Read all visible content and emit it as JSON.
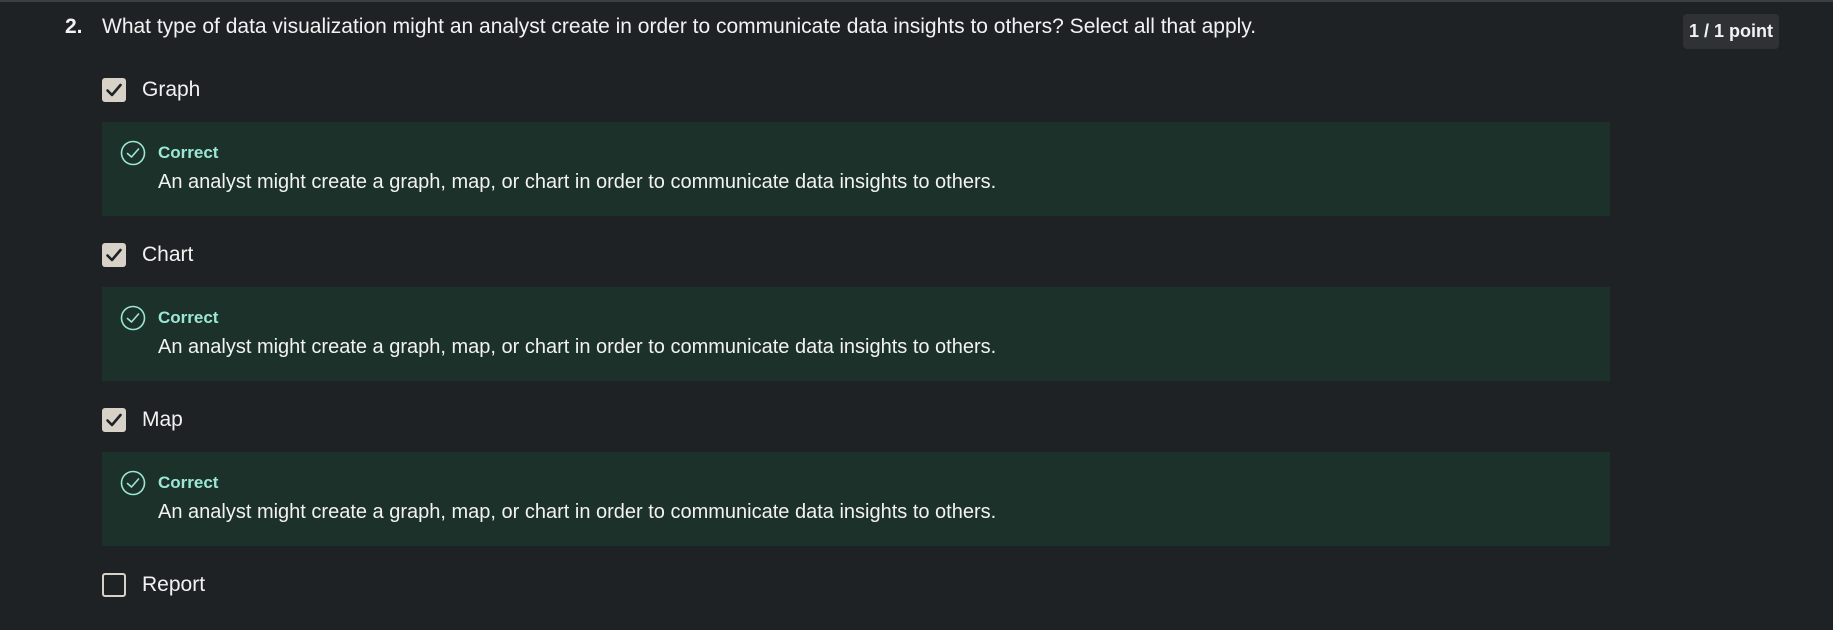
{
  "question": {
    "number": "2.",
    "text": "What type of data visualization might an analyst create in order to communicate data insights to others? Select all that apply.",
    "points": "1 / 1 point"
  },
  "options": [
    {
      "label": "Graph",
      "checked": true,
      "feedback": {
        "status": "Correct",
        "text": "An analyst might create a graph, map, or chart in order to communicate data insights to others."
      }
    },
    {
      "label": "Chart",
      "checked": true,
      "feedback": {
        "status": "Correct",
        "text": "An analyst might create a graph, map, or chart in order to communicate data insights to others."
      }
    },
    {
      "label": "Map",
      "checked": true,
      "feedback": {
        "status": "Correct",
        "text": "An analyst might create a graph, map, or chart in order to communicate data insights to others."
      }
    },
    {
      "label": "Report",
      "checked": false
    }
  ],
  "colors": {
    "background": "#1f2224",
    "feedback_background": "#1c3129",
    "correct_accent": "#9be7d5",
    "checkbox": "#d8d1c8"
  }
}
